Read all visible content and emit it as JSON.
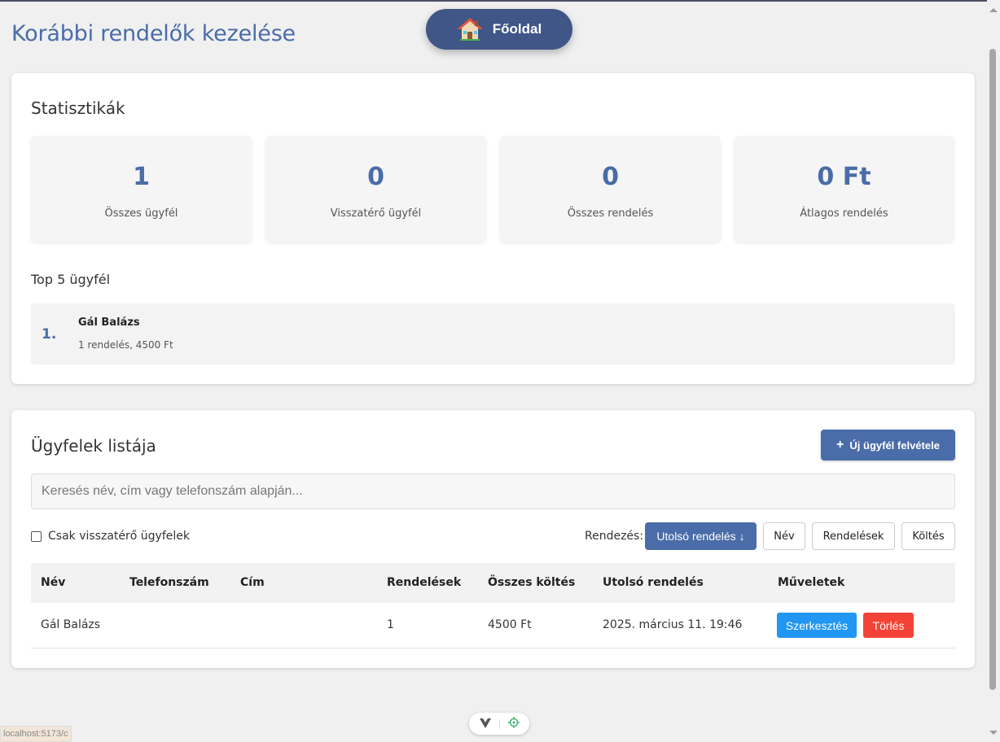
{
  "header": {
    "title": "Korábbi rendelők kezelése",
    "home_label": "Főoldal"
  },
  "stats": {
    "title": "Statisztikák",
    "cards": [
      {
        "value": "1",
        "label": "Összes ügyfél"
      },
      {
        "value": "0",
        "label": "Visszatérő ügyfél"
      },
      {
        "value": "0",
        "label": "Összes rendelés"
      },
      {
        "value": "0 Ft",
        "label": "Átlagos rendelés"
      }
    ],
    "top_title": "Top 5 ügyfél",
    "top_items": [
      {
        "rank": "1.",
        "name": "Gál Balázs",
        "meta": "1 rendelés, 4500 Ft"
      }
    ]
  },
  "customers": {
    "title": "Ügyfelek listája",
    "new_button": "Új ügyfél felvétele",
    "search_placeholder": "Keresés név, cím vagy telefonszám alapján...",
    "returning_only_label": "Csak visszatérő ügyfelek",
    "sort_label": "Rendezés:",
    "sort_options": [
      "Utolsó rendelés ↓",
      "Név",
      "Rendelések",
      "Költés"
    ],
    "columns": [
      "Név",
      "Telefonszám",
      "Cím",
      "Rendelések",
      "Összes költés",
      "Utolsó rendelés",
      "Műveletek"
    ],
    "rows": [
      {
        "name": "Gál Balázs",
        "phone": "",
        "address": "",
        "orders": "1",
        "total": "4500 Ft",
        "last_order": "2025. március 11. 19:46"
      }
    ],
    "edit_label": "Szerkesztés",
    "delete_label": "Törlés"
  },
  "statusbar": {
    "url": "localhost:5173/c"
  },
  "colors": {
    "accent": "#4a6ca8",
    "home_button": "#3f5686",
    "edit": "#2196f3",
    "delete": "#f44336"
  },
  "icons": {
    "home": "house-icon",
    "new": "plus-icon",
    "devtools": [
      "vue-icon",
      "target-icon"
    ]
  }
}
